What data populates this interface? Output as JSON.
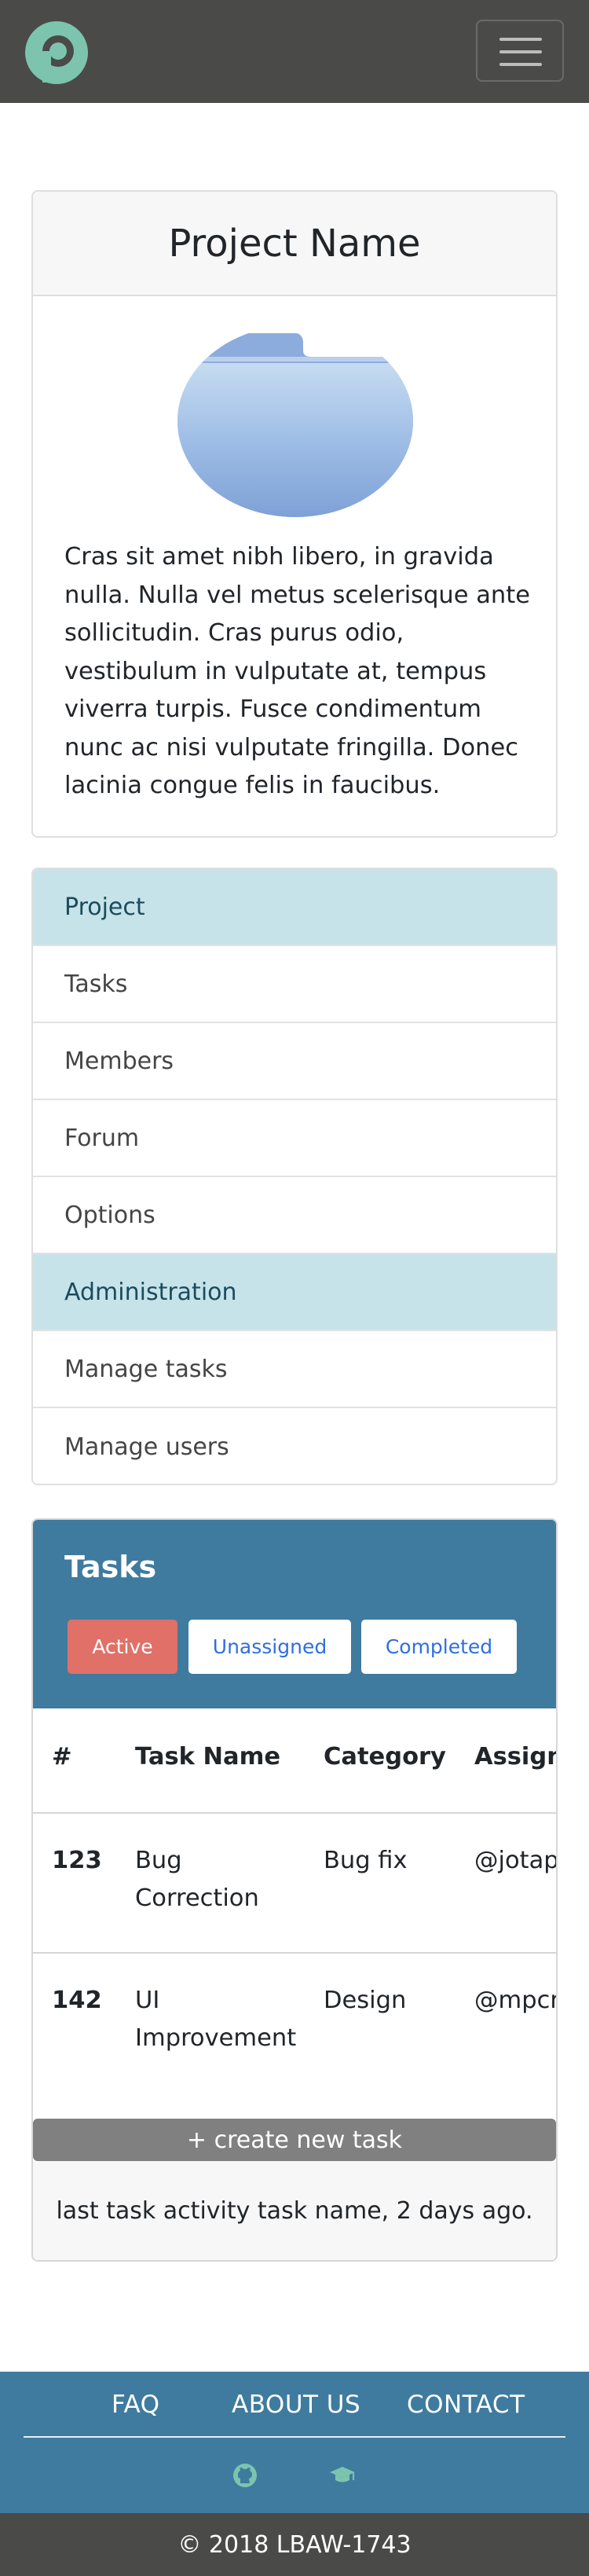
{
  "project": {
    "title": "Project Name",
    "description": "Cras sit amet nibh libero, in gravida nulla. Nulla vel metus scelerisque ante sollicitudin. Cras purus odio, vestibulum in vulputate at, tempus viverra turpis. Fusce condimentum nunc ac nisi vulputate fringilla. Donec lacinia congue felis in faucibus.",
    "image_icon": "folder-icon"
  },
  "menu": {
    "items": [
      {
        "label": "Project"
      },
      {
        "label": "Tasks"
      },
      {
        "label": "Members"
      },
      {
        "label": "Forum"
      },
      {
        "label": "Options"
      },
      {
        "label": "Administration"
      },
      {
        "label": "Manage tasks"
      },
      {
        "label": "Manage users"
      }
    ]
  },
  "tasks": {
    "title": "Tasks",
    "filters": {
      "active": "Active",
      "unassigned": "Unassigned",
      "completed": "Completed"
    },
    "columns": [
      "#",
      "Task Name",
      "Category",
      "Assigned"
    ],
    "rows": [
      {
        "id": "123",
        "name": "Bug Correction",
        "category": "Bug fix",
        "assigned": "@jotapsa"
      },
      {
        "id": "142",
        "name": "UI Improvement",
        "category": "Design",
        "assigned": "@mpcraig"
      }
    ],
    "create_label": "+ create new task",
    "last_activity": "last task activity task name, 2 days ago."
  },
  "footer": {
    "links": {
      "faq": "FAQ",
      "about": "ABOUT US",
      "contact": "CONTACT"
    },
    "icons": [
      "github-icon",
      "graduation-cap-icon"
    ],
    "copyright": "© 2018 LBAW-1743"
  },
  "colors": {
    "navbar": "#4a4a48",
    "accent_teal": "#7cc4ae",
    "tasks_header": "#3f7b9f",
    "active_pill": "#e07068",
    "menu_header": "#c6e3ea"
  }
}
